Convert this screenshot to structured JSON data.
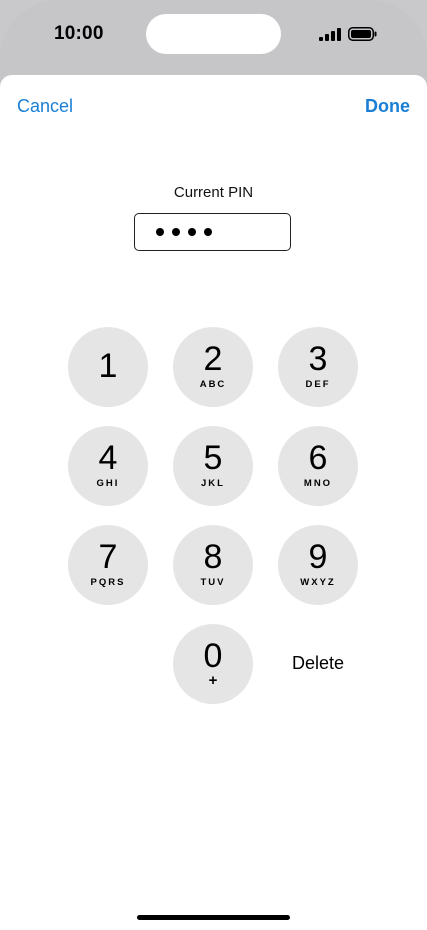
{
  "status_bar": {
    "time": "10:00"
  },
  "nav": {
    "cancel_label": "Cancel",
    "done_label": "Done"
  },
  "pin": {
    "label": "Current PIN",
    "entered_length": 4
  },
  "keypad": {
    "keys": [
      {
        "digit": "1",
        "letters": ""
      },
      {
        "digit": "2",
        "letters": "ABC"
      },
      {
        "digit": "3",
        "letters": "DEF"
      },
      {
        "digit": "4",
        "letters": "GHI"
      },
      {
        "digit": "5",
        "letters": "JKL"
      },
      {
        "digit": "6",
        "letters": "MNO"
      },
      {
        "digit": "7",
        "letters": "PQRS"
      },
      {
        "digit": "8",
        "letters": "TUV"
      },
      {
        "digit": "9",
        "letters": "WXYZ"
      },
      {
        "digit": "0",
        "letters": "+"
      }
    ],
    "delete_label": "Delete"
  },
  "colors": {
    "accent": "#1a7fd4",
    "key_background": "#e5e5e6"
  }
}
